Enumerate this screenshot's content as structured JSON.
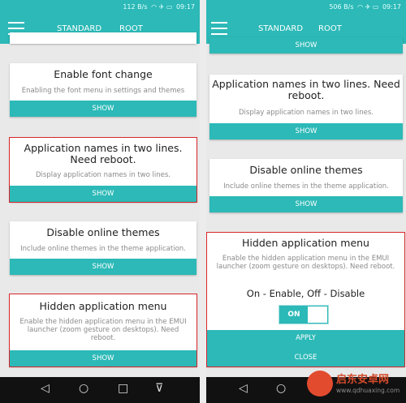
{
  "left": {
    "status": {
      "speed": "112 B/s",
      "time": "09:17"
    },
    "tabs": [
      "STANDARD",
      "ROOT"
    ],
    "top_partial_label": "",
    "cards": [
      {
        "title": "Enable font change",
        "desc": "Enabling the font menu in settings and themes",
        "button": "SHOW"
      },
      {
        "title": "Application names in two lines. Need reboot.",
        "desc": "Display application names in two lines.",
        "button": "SHOW"
      },
      {
        "title": "Disable online themes",
        "desc": "Include online themes in the theme application.",
        "button": "SHOW"
      },
      {
        "title": "Hidden application menu",
        "desc": "Enable the hidden application menu in the EMUI launcher (zoom gesture on desktops). Need reboot.",
        "button": "SHOW"
      }
    ]
  },
  "right": {
    "status": {
      "speed": "506 B/s",
      "time": "09:17"
    },
    "tabs": [
      "STANDARD",
      "ROOT"
    ],
    "top_partial_label": "SHOW",
    "cards": [
      {
        "title": "Application names in two lines. Need reboot.",
        "desc": "Display application names in two lines.",
        "button": "SHOW"
      },
      {
        "title": "Disable online themes",
        "desc": "Include online themes in the theme application.",
        "button": "SHOW"
      }
    ],
    "expanded": {
      "title": "Hidden application menu",
      "desc": "Enable the hidden application menu in the EMUI launcher (zoom gesture on desktops). Need reboot.",
      "hint": "On - Enable, Off - Disable",
      "toggle": "ON",
      "apply": "APPLY",
      "close": "CLOSE"
    }
  },
  "navbar": {
    "back": "◁",
    "home": "○",
    "recent": "□",
    "down": "⊽"
  },
  "watermark": {
    "title": "启东安卓网",
    "url": "www.qdhuaxing.com"
  },
  "colors": {
    "accent": "#2cb9b7",
    "highlight": "#d6262b"
  }
}
